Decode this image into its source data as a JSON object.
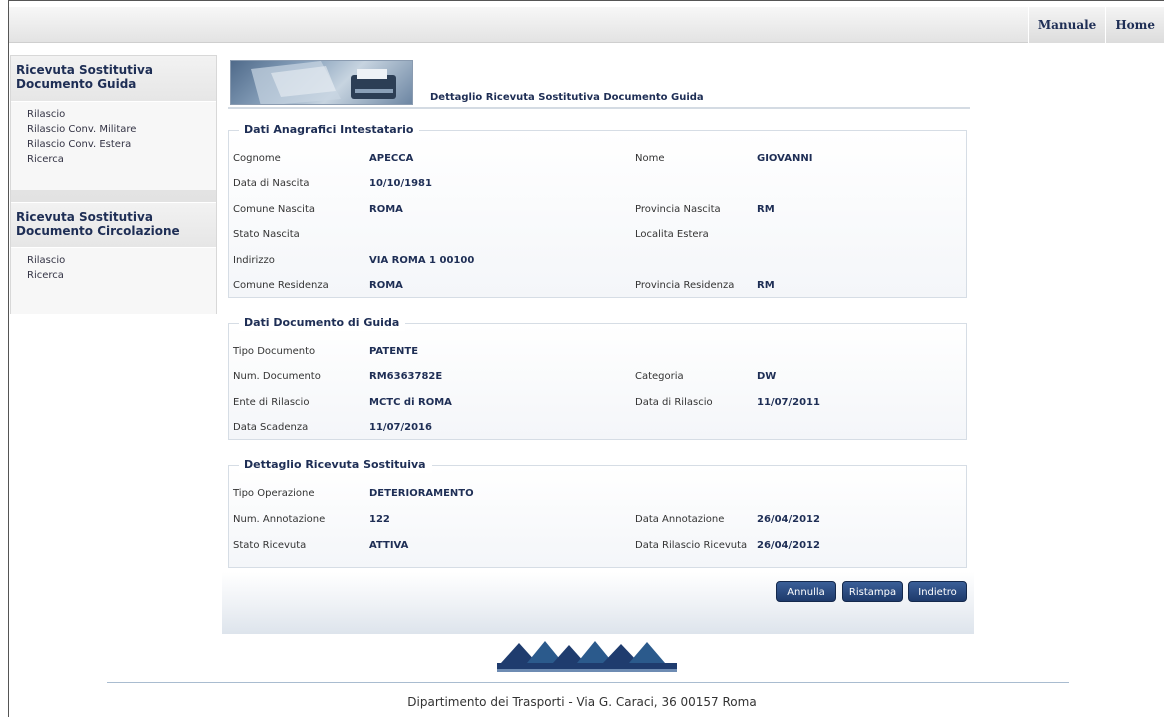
{
  "topnav": {
    "manuale": "Manuale",
    "home": "Home"
  },
  "sidebar": {
    "sections": [
      {
        "title": "Ricevuta Sostitutiva Documento Guida",
        "items": [
          "Rilascio",
          "Rilascio Conv. Militare",
          "Rilascio Conv. Estera",
          "Ricerca"
        ]
      },
      {
        "title": "Ricevuta Sostitutiva Documento Circolazione",
        "items": [
          "Rilascio",
          "Ricerca"
        ]
      }
    ]
  },
  "header": {
    "title": "Dettaglio Ricevuta Sostitutiva Documento Guida"
  },
  "anagrafici": {
    "legend": "Dati Anagrafici Intestatario",
    "cognome_label": "Cognome",
    "cognome": "APECCA",
    "nome_label": "Nome",
    "nome": "GIOVANNI",
    "data_nascita_label": "Data di Nascita",
    "data_nascita": "10/10/1981",
    "comune_nascita_label": "Comune Nascita",
    "comune_nascita": "ROMA",
    "provincia_nascita_label": "Provincia Nascita",
    "provincia_nascita": "RM",
    "stato_nascita_label": "Stato Nascita",
    "localita_estera_label": "Localita Estera",
    "indirizzo_label": "Indirizzo",
    "indirizzo": "VIA ROMA 1 00100",
    "comune_residenza_label": "Comune Residenza",
    "comune_residenza": "ROMA",
    "provincia_residenza_label": "Provincia Residenza",
    "provincia_residenza": "RM"
  },
  "documento": {
    "legend": "Dati Documento di Guida",
    "tipo_label": "Tipo Documento",
    "tipo": "PATENTE",
    "num_label": "Num. Documento",
    "num": "RM6363782E",
    "categoria_label": "Categoria",
    "categoria": "DW",
    "ente_label": "Ente di Rilascio",
    "ente": "MCTC di ROMA",
    "data_rilascio_label": "Data di Rilascio",
    "data_rilascio": "11/07/2011",
    "scadenza_label": "Data Scadenza",
    "scadenza": "11/07/2016"
  },
  "ricevuta": {
    "legend": "Dettaglio Ricevuta Sostituiva",
    "tipo_op_label": "Tipo Operazione",
    "tipo_op": "DETERIORAMENTO",
    "num_annot_label": "Num. Annotazione",
    "num_annot": "122",
    "data_annot_label": "Data Annotazione",
    "data_annot": "26/04/2012",
    "stato_label": "Stato Ricevuta",
    "stato": "ATTIVA",
    "data_ril_label": "Data Rilascio Ricevuta",
    "data_ril": "26/04/2012"
  },
  "buttons": {
    "annulla": "Annulla",
    "ristampa": "Ristampa",
    "indietro": "Indietro"
  },
  "footer": {
    "text": "Dipartimento dei Trasporti - Via G. Caraci, 36 00157 Roma"
  }
}
